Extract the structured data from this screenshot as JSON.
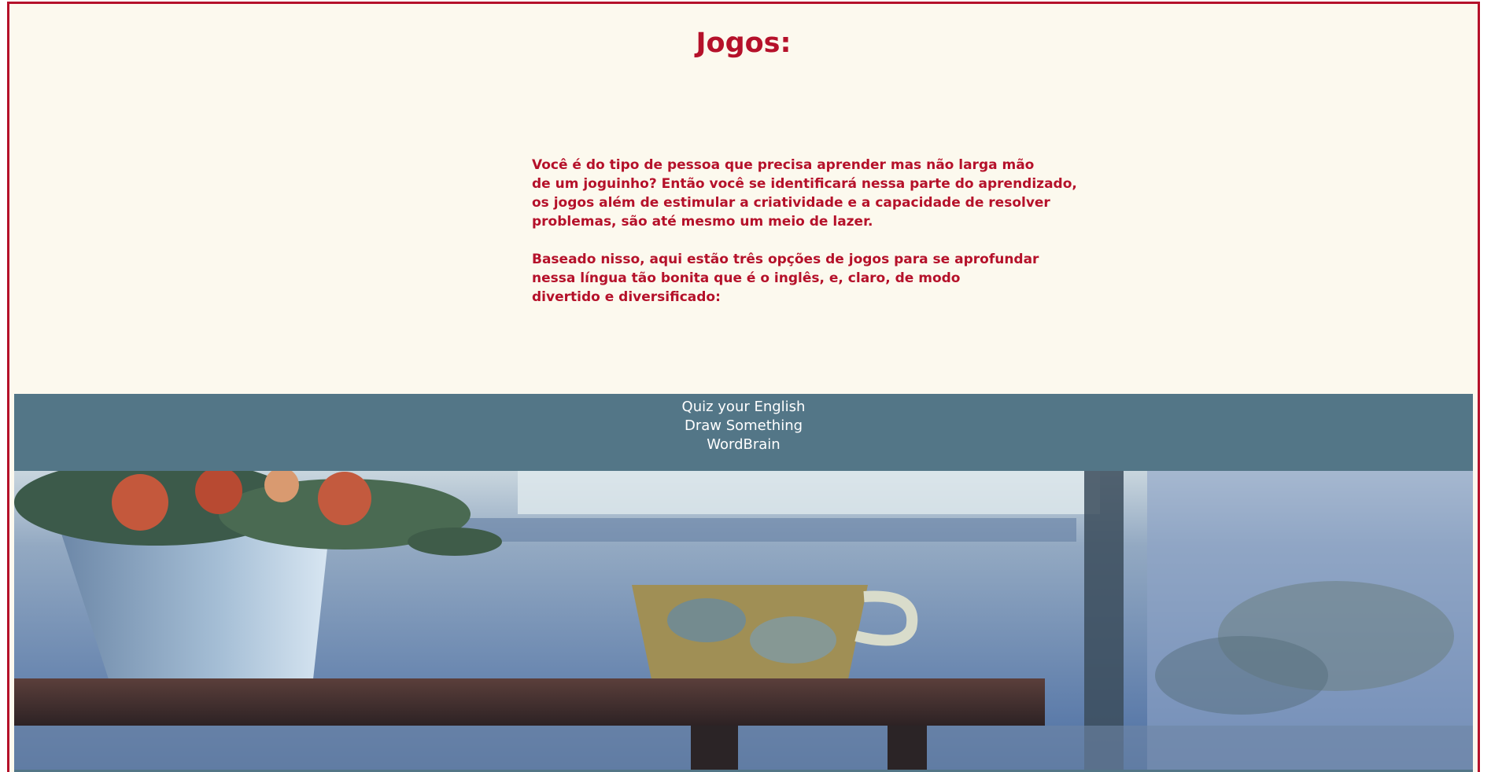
{
  "page": {
    "title": "Jogos:"
  },
  "intro": {
    "paragraph1_lines": [
      "Você é do tipo de pessoa que precisa aprender mas não larga mão",
      "de um joguinho? Então você se identificará nessa parte do aprendizado,",
      "os jogos além de estimular a criatividade e a capacidade de resolver",
      "problemas, são até mesmo um meio de lazer."
    ],
    "paragraph2_lines": [
      "Baseado nisso, aqui estão três opções de jogos para se aprofundar",
      "nessa língua tão bonita que é o inglês, e, claro, de modo",
      "divertido e diversificado:"
    ]
  },
  "games_nav": {
    "links": [
      "Quiz your English",
      "Draw Something",
      "WordBrain"
    ]
  },
  "colors": {
    "accent": "#b5112a",
    "background": "#fcf9ee",
    "nav_background": "#537687",
    "nav_text": "#ffffff"
  }
}
